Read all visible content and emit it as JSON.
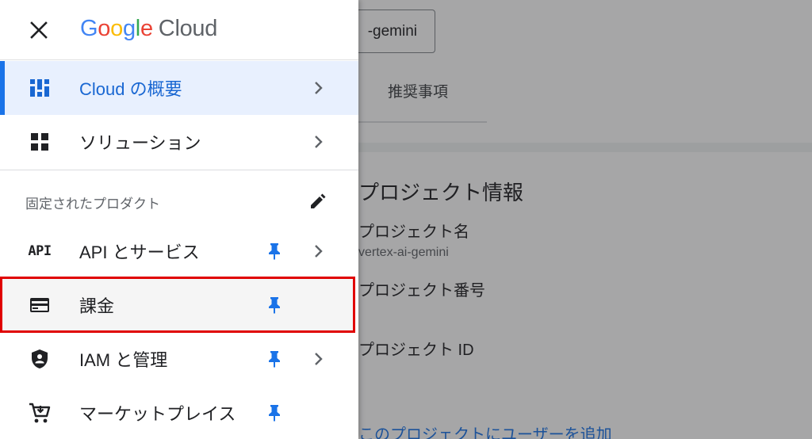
{
  "background": {
    "project_selector": "-gemini",
    "tab_recommendations": "推奨事項",
    "card_title": "プロジェクト情報",
    "project_name_label": "プロジェクト名",
    "project_name_value": "vertex-ai-gemini",
    "project_number_label": "プロジェクト番号",
    "project_id_label": "プロジェクト ID",
    "add_user_link": "このプロジェクトにユーザーを追加"
  },
  "drawer": {
    "logo": {
      "g1": "G",
      "o1": "o",
      "o2": "o",
      "g2": "g",
      "l": "l",
      "e": "e",
      "cloud": "Cloud"
    },
    "top_items": [
      {
        "label": "Cloud の概要",
        "icon": "dashboard-icon"
      },
      {
        "label": "ソリューション",
        "icon": "grid-icon"
      }
    ],
    "pinned_section_title": "固定されたプロダクト",
    "pinned_items": [
      {
        "label": "API とサービス",
        "icon": "api-icon",
        "icon_text": "API"
      },
      {
        "label": "課金",
        "icon": "billing-card-icon"
      },
      {
        "label": "IAM と管理",
        "icon": "shield-icon"
      },
      {
        "label": "マーケットプレイス",
        "icon": "cart-icon"
      }
    ]
  },
  "colors": {
    "accent": "#1a73e8",
    "active_bg": "#e8f0fe",
    "highlight_border": "#e00000",
    "pin": "#1a73e8"
  }
}
